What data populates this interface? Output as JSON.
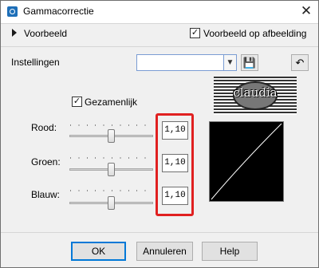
{
  "window": {
    "title": "Gammacorrectie",
    "close_glyph": "✕",
    "icon": "gamma-app-icon"
  },
  "preview": {
    "label": "Voorbeeld",
    "preview_on_image_label": "Voorbeeld op afbeelding",
    "preview_on_image_checked": true
  },
  "settings": {
    "label": "Instellingen",
    "preset_value": "",
    "save_icon": "floppy-disk-icon",
    "reset_icon": "reset-icon"
  },
  "stamp": {
    "text": "claudia"
  },
  "linked": {
    "label": "Gezamenlijk",
    "checked": true
  },
  "channels": [
    {
      "label": "Rood:",
      "value": "1,10",
      "slider_level": 0.5
    },
    {
      "label": "Groen:",
      "value": "1,10",
      "slider_level": 0.5
    },
    {
      "label": "Blauw:",
      "value": "1,10",
      "slider_level": 0.5
    }
  ],
  "buttons": {
    "ok": "OK",
    "cancel": "Annuleren",
    "help": "Help"
  },
  "check_glyph": "✓",
  "colors": {
    "highlight": "#e02020",
    "focus": "#0078d7"
  }
}
